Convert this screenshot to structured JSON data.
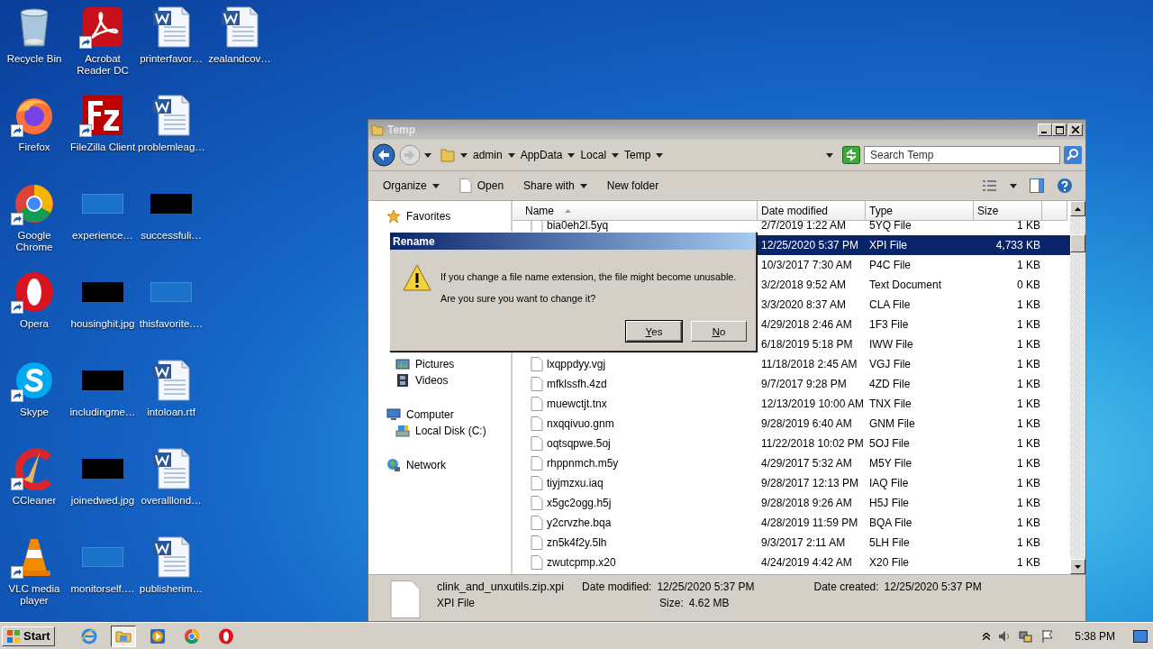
{
  "desktop": {
    "icons": [
      {
        "label": "Recycle Bin",
        "kind": "recycle",
        "shortcut": false
      },
      {
        "label": "Firefox",
        "kind": "firefox",
        "shortcut": true
      },
      {
        "label": "Google Chrome",
        "kind": "chrome",
        "shortcut": true
      },
      {
        "label": "Opera",
        "kind": "opera",
        "shortcut": true
      },
      {
        "label": "Skype",
        "kind": "skype",
        "shortcut": true
      },
      {
        "label": "CCleaner",
        "kind": "ccleaner",
        "shortcut": true
      },
      {
        "label": "VLC media player",
        "kind": "vlc",
        "shortcut": true
      },
      {
        "label": "Acrobat Reader DC",
        "kind": "acrobat",
        "shortcut": true
      },
      {
        "label": "FileZilla Client",
        "kind": "filezilla",
        "shortcut": true
      },
      {
        "label": "experience…",
        "kind": "thumb-light",
        "shortcut": false
      },
      {
        "label": "housinghit.jpg",
        "kind": "thumb-dark",
        "shortcut": false
      },
      {
        "label": "includingme…",
        "kind": "thumb-dark",
        "shortcut": false
      },
      {
        "label": "joinedwed.jpg",
        "kind": "thumb-dark",
        "shortcut": false
      },
      {
        "label": "monitorself.…",
        "kind": "thumb-light",
        "shortcut": false
      },
      {
        "label": "printerfavor…",
        "kind": "word",
        "shortcut": false
      },
      {
        "label": "problemleag…",
        "kind": "word",
        "shortcut": false
      },
      {
        "label": "successfuli…",
        "kind": "thumb-dark",
        "shortcut": false
      },
      {
        "label": "thisfavorite.…",
        "kind": "thumb-light",
        "shortcut": false
      },
      {
        "label": "intoloan.rtf",
        "kind": "word",
        "shortcut": false
      },
      {
        "label": "overalllond…",
        "kind": "word",
        "shortcut": false
      },
      {
        "label": "publisherim…",
        "kind": "word",
        "shortcut": false
      },
      {
        "label": "zealandcov…",
        "kind": "word",
        "shortcut": false
      }
    ]
  },
  "explorer": {
    "title": "Temp",
    "breadcrumb": [
      "admin",
      "AppData",
      "Local",
      "Temp"
    ],
    "search": {
      "placeholder": "Search Temp"
    },
    "toolbar": [
      {
        "label": "Organize",
        "kind": "menu"
      },
      {
        "label": "Open",
        "kind": "open"
      },
      {
        "label": "Share with",
        "kind": "menu"
      },
      {
        "label": "New folder",
        "kind": "plain"
      }
    ],
    "nav": [
      {
        "label": "Favorites",
        "kind": "favorites"
      },
      {
        "label": "Pictures",
        "kind": "pictures"
      },
      {
        "label": "Videos",
        "kind": "videos"
      },
      {
        "label": "Computer",
        "kind": "computer"
      },
      {
        "label": "Local Disk (C:)",
        "kind": "disk"
      },
      {
        "label": "Network",
        "kind": "network"
      }
    ],
    "columns": [
      "Name",
      "Date modified",
      "Type",
      "Size"
    ],
    "rows": [
      {
        "name": "bia0eh2l.5yq",
        "date": "2/7/2019 1:22 AM",
        "type": "5YQ File",
        "size": "1 KB",
        "selected": false
      },
      {
        "date": "12/25/2020 5:37 PM",
        "type": "XPI File",
        "size": "4,733 KB",
        "selected": true
      },
      {
        "date": "10/3/2017 7:30 AM",
        "type": "P4C File",
        "size": "1 KB",
        "selected": false
      },
      {
        "date": "3/2/2018 9:52 AM",
        "type": "Text Document",
        "size": "0 KB",
        "selected": false
      },
      {
        "date": "3/3/2020 8:37 AM",
        "type": "CLA File",
        "size": "1 KB",
        "selected": false
      },
      {
        "date": "4/29/2018 2:46 AM",
        "type": "1F3 File",
        "size": "1 KB",
        "selected": false
      },
      {
        "date": "6/18/2019 5:18 PM",
        "type": "IWW File",
        "size": "1 KB",
        "selected": false
      },
      {
        "name": "lxqppdyy.vgj",
        "date": "11/18/2018 2:45 AM",
        "type": "VGJ File",
        "size": "1 KB",
        "selected": false
      },
      {
        "name": "mfklssfh.4zd",
        "date": "9/7/2017 9:28 PM",
        "type": "4ZD File",
        "size": "1 KB",
        "selected": false
      },
      {
        "name": "muewctjt.tnx",
        "date": "12/13/2019 10:00 AM",
        "type": "TNX File",
        "size": "1 KB",
        "selected": false
      },
      {
        "name": "nxqqivuo.gnm",
        "date": "9/28/2019 6:40 AM",
        "type": "GNM File",
        "size": "1 KB",
        "selected": false
      },
      {
        "name": "oqtsqpwe.5oj",
        "date": "11/22/2018 10:02 PM",
        "type": "5OJ File",
        "size": "1 KB",
        "selected": false
      },
      {
        "name": "rhppnmch.m5y",
        "date": "4/29/2017 5:32 AM",
        "type": "M5Y File",
        "size": "1 KB",
        "selected": false
      },
      {
        "name": "tiyjmzxu.iaq",
        "date": "9/28/2017 12:13 PM",
        "type": "IAQ File",
        "size": "1 KB",
        "selected": false
      },
      {
        "name": "x5gc2ogg.h5j",
        "date": "9/28/2018 9:26 AM",
        "type": "H5J File",
        "size": "1 KB",
        "selected": false
      },
      {
        "name": "y2crvzhe.bqa",
        "date": "4/28/2019 11:59 PM",
        "type": "BQA File",
        "size": "1 KB",
        "selected": false
      },
      {
        "name": "zn5k4f2y.5lh",
        "date": "9/3/2017 2:11 AM",
        "type": "5LH File",
        "size": "1 KB",
        "selected": false
      },
      {
        "name": "zwutcpmp.x20",
        "date": "4/24/2019 4:42 AM",
        "type": "X20 File",
        "size": "1 KB",
        "selected": false
      }
    ],
    "details": {
      "name": "clink_and_unxutils.zip.xpi",
      "type": "XPI File",
      "modified_label": "Date modified:",
      "modified": "12/25/2020 5:37 PM",
      "size_label": "Size:",
      "size": "4.62 MB",
      "created_label": "Date created:",
      "created": "12/25/2020 5:37 PM"
    }
  },
  "dialog": {
    "title": "Rename",
    "message": "If you change a file name extension, the file might become unusable.",
    "question": "Are you sure you want to change it?",
    "buttons": [
      {
        "label": "Yes",
        "selected": true
      },
      {
        "label": "No",
        "selected": false
      }
    ]
  },
  "taskbar": {
    "start": "Start",
    "apps": [
      {
        "kind": "ie",
        "selected": false
      },
      {
        "kind": "explorer",
        "selected": true
      },
      {
        "kind": "media",
        "selected": false
      },
      {
        "kind": "chrome",
        "selected": false
      },
      {
        "kind": "opera",
        "selected": false
      }
    ],
    "clock": "5:38 PM"
  }
}
